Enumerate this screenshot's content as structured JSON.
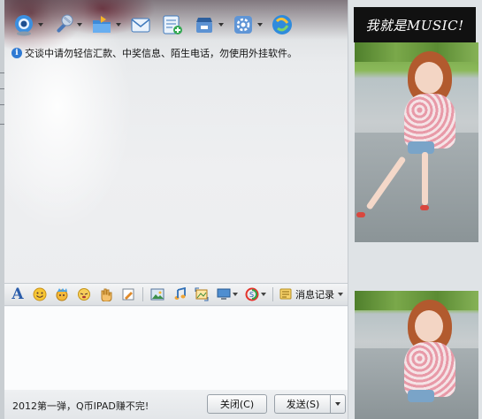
{
  "window": {
    "notice_text": "交谈中请勿轻信汇款、中奖信息、陌生电话，勿使用外挂软件。"
  },
  "toolbar": {
    "buttons": [
      {
        "name": "video-call",
        "icon": "webcam-icon"
      },
      {
        "name": "voice-call",
        "icon": "microphone-icon"
      },
      {
        "name": "send-file",
        "icon": "folder-icon"
      },
      {
        "name": "send-email",
        "icon": "envelope-icon"
      },
      {
        "name": "create-group",
        "icon": "group-add-icon"
      },
      {
        "name": "apps",
        "icon": "app-center-icon"
      },
      {
        "name": "settings",
        "icon": "gear-icon"
      },
      {
        "name": "qzone",
        "icon": "orb-icon"
      }
    ]
  },
  "input_toolbar": {
    "history_label": "消息记录"
  },
  "bottom_bar": {
    "promo_text": "2012第一弹，Q币IPAD赚不完!",
    "close_label": "关闭(C)",
    "send_label": "发送(S)"
  },
  "right_panel": {
    "banner_text": "我就是MUSIC!"
  },
  "colors": {
    "accent_blue": "#2f7ad3",
    "banner_bg": "#111111",
    "window_bg": "#eef0f2"
  }
}
